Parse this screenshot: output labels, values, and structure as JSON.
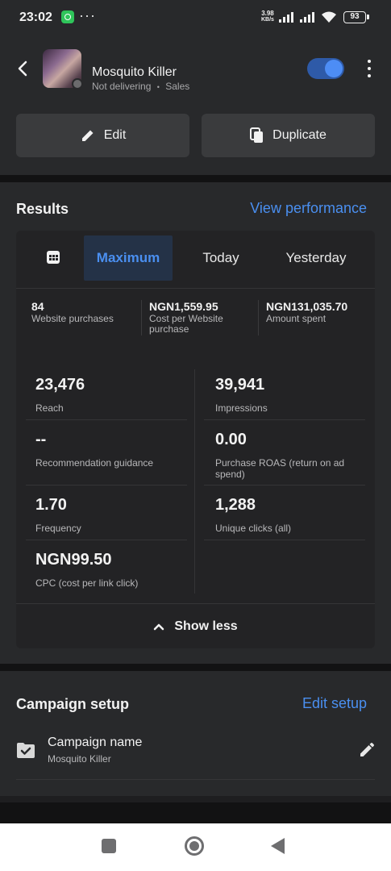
{
  "status_bar": {
    "time": "23:02",
    "more": "···",
    "net_speed": "3.98",
    "net_unit": "KB/s",
    "battery": "93",
    "icons": [
      "whatsapp-icon",
      "signal-icon",
      "signal-icon",
      "wifi-icon",
      "battery-icon"
    ]
  },
  "header": {
    "ad_name": "Mosquito Killer",
    "status": "Not delivering",
    "separator": "•",
    "objective": "Sales",
    "toggle_on": true,
    "edit_label": "Edit",
    "duplicate_label": "Duplicate"
  },
  "results": {
    "title": "Results",
    "view_performance": "View performance",
    "tabs": [
      "Maximum",
      "Today",
      "Yesterday"
    ],
    "active_tab": "Maximum",
    "kpis": [
      {
        "value": "84",
        "label": "Website purchases"
      },
      {
        "value": "NGN1,559.95",
        "label": "Cost per Website purchase"
      },
      {
        "value": "NGN131,035.70",
        "label": "Amount spent"
      }
    ],
    "metrics": [
      {
        "value": "23,476",
        "label": "Reach"
      },
      {
        "value": "39,941",
        "label": "Impressions"
      },
      {
        "value": "--",
        "label": "Recommendation guidance"
      },
      {
        "value": "0.00",
        "label": "Purchase ROAS (return on ad spend)"
      },
      {
        "value": "1.70",
        "label": "Frequency"
      },
      {
        "value": "1,288",
        "label": "Unique clicks (all)"
      },
      {
        "value": "NGN99.50",
        "label": "CPC (cost per link click)"
      }
    ],
    "show_less": "Show less"
  },
  "campaign_setup": {
    "title": "Campaign setup",
    "edit_setup": "Edit setup",
    "row_title": "Campaign name",
    "row_value": "Mosquito Killer"
  },
  "colors": {
    "accent": "#4a8ff0",
    "background": "#28292b",
    "tab_active_bg": "#243247"
  }
}
